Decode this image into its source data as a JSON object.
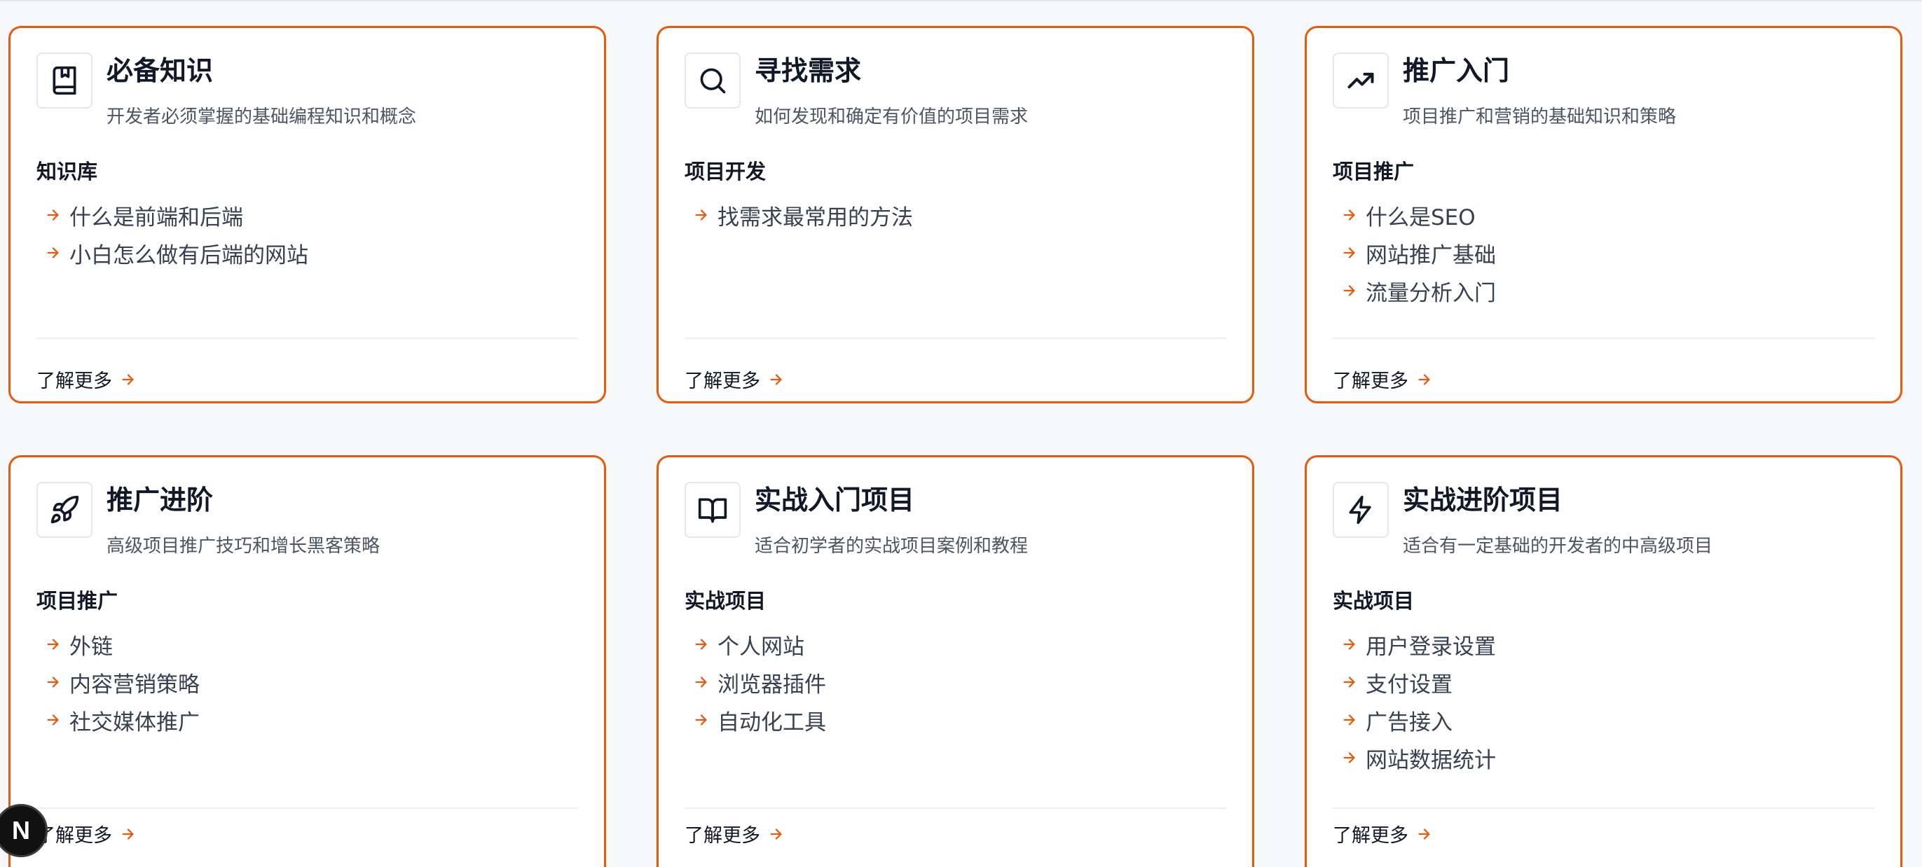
{
  "accent_color": "#ea580c",
  "cards": [
    {
      "icon": "bookmark-book-icon",
      "title": "必备知识",
      "subtitle": "开发者必须掌握的基础编程知识和概念",
      "section": "知识库",
      "items": [
        "什么是前端和后端",
        "小白怎么做有后端的网站"
      ],
      "more": "了解更多"
    },
    {
      "icon": "search-icon",
      "title": "寻找需求",
      "subtitle": "如何发现和确定有价值的项目需求",
      "section": "项目开发",
      "items": [
        "找需求最常用的方法"
      ],
      "more": "了解更多"
    },
    {
      "icon": "trending-up-icon",
      "title": "推广入门",
      "subtitle": "项目推广和营销的基础知识和策略",
      "section": "项目推广",
      "items": [
        "什么是SEO",
        "网站推广基础",
        "流量分析入门"
      ],
      "more": "了解更多"
    },
    {
      "icon": "rocket-icon",
      "title": "推广进阶",
      "subtitle": "高级项目推广技巧和增长黑客策略",
      "section": "项目推广",
      "items": [
        "外链",
        "内容营销策略",
        "社交媒体推广"
      ],
      "more": "了解更多"
    },
    {
      "icon": "open-book-icon",
      "title": "实战入门项目",
      "subtitle": "适合初学者的实战项目案例和教程",
      "section": "实战项目",
      "items": [
        "个人网站",
        "浏览器插件",
        "自动化工具"
      ],
      "more": "了解更多"
    },
    {
      "icon": "lightning-icon",
      "title": "实战进阶项目",
      "subtitle": "适合有一定基础的开发者的中高级项目",
      "section": "实战项目",
      "items": [
        "用户登录设置",
        "支付设置",
        "广告接入",
        "网站数据统计"
      ],
      "more": "了解更多"
    }
  ],
  "badge": {
    "letter": "N"
  }
}
